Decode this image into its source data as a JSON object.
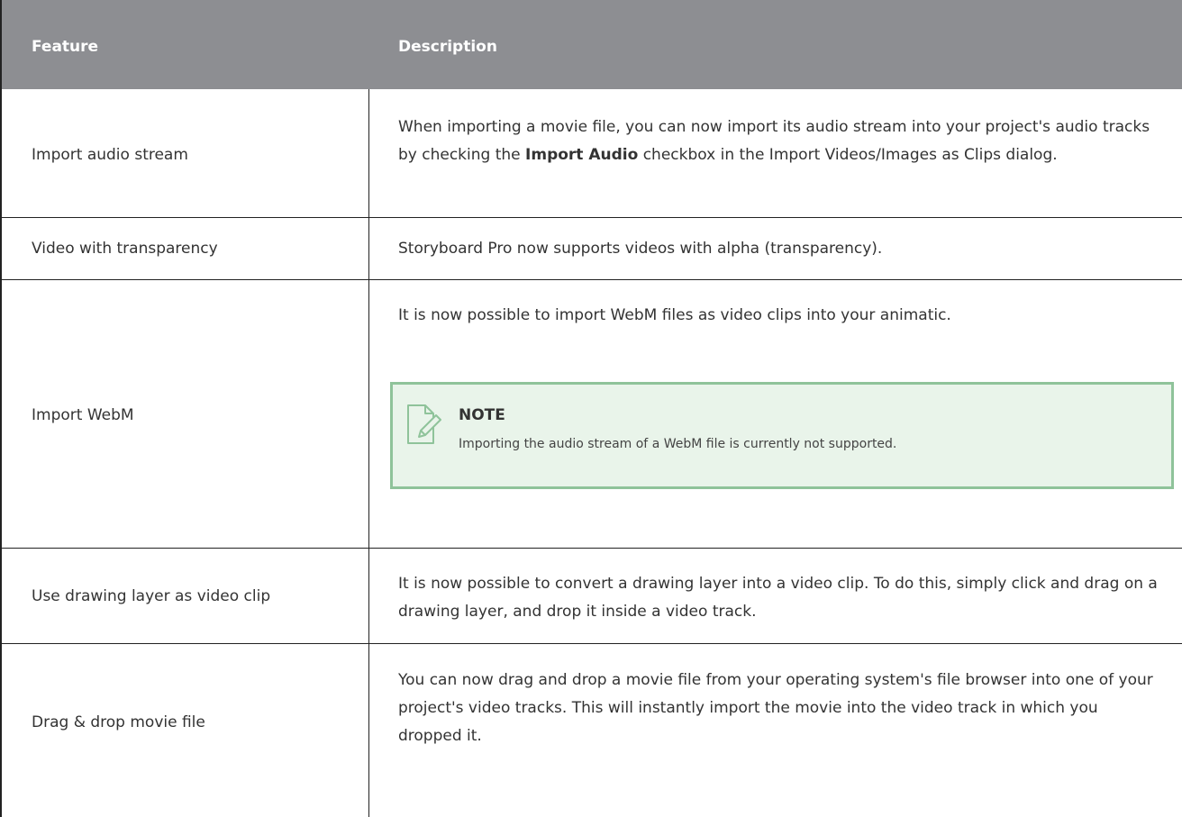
{
  "header": {
    "feature": "Feature",
    "description": "Description"
  },
  "rows": [
    {
      "feature": "Import audio stream",
      "description_parts": [
        "When importing a movie file, you can now import its audio stream into your project's audio tracks by checking the ",
        "Import Audio",
        " checkbox in the Import Videos/Images as Clips dialog."
      ]
    },
    {
      "feature": "Video with transparency",
      "description": "Storyboard Pro now supports videos with alpha (transparency)."
    },
    {
      "feature": "Import WebM",
      "description": "It is now possible to import WebM files as video clips into your animatic.",
      "note": {
        "title": "NOTE",
        "text": "Importing the audio stream of a WebM file is currently not supported.",
        "icon": "note-edit-icon"
      }
    },
    {
      "feature": "Use drawing layer as video clip",
      "description": "It is now possible to convert a drawing layer into a video clip. To do this, simply click and drag on a drawing layer, and drop it inside a video track."
    },
    {
      "feature": "Drag & drop movie file",
      "description": "You can now drag and drop a movie file from your operating system's file browser into one of your project's video tracks. This will instantly import the movie into the video track in which you dropped it."
    }
  ],
  "colors": {
    "header_bg": "#8d8e92",
    "note_bg": "#e9f4ea",
    "note_border": "#8fc39a"
  }
}
